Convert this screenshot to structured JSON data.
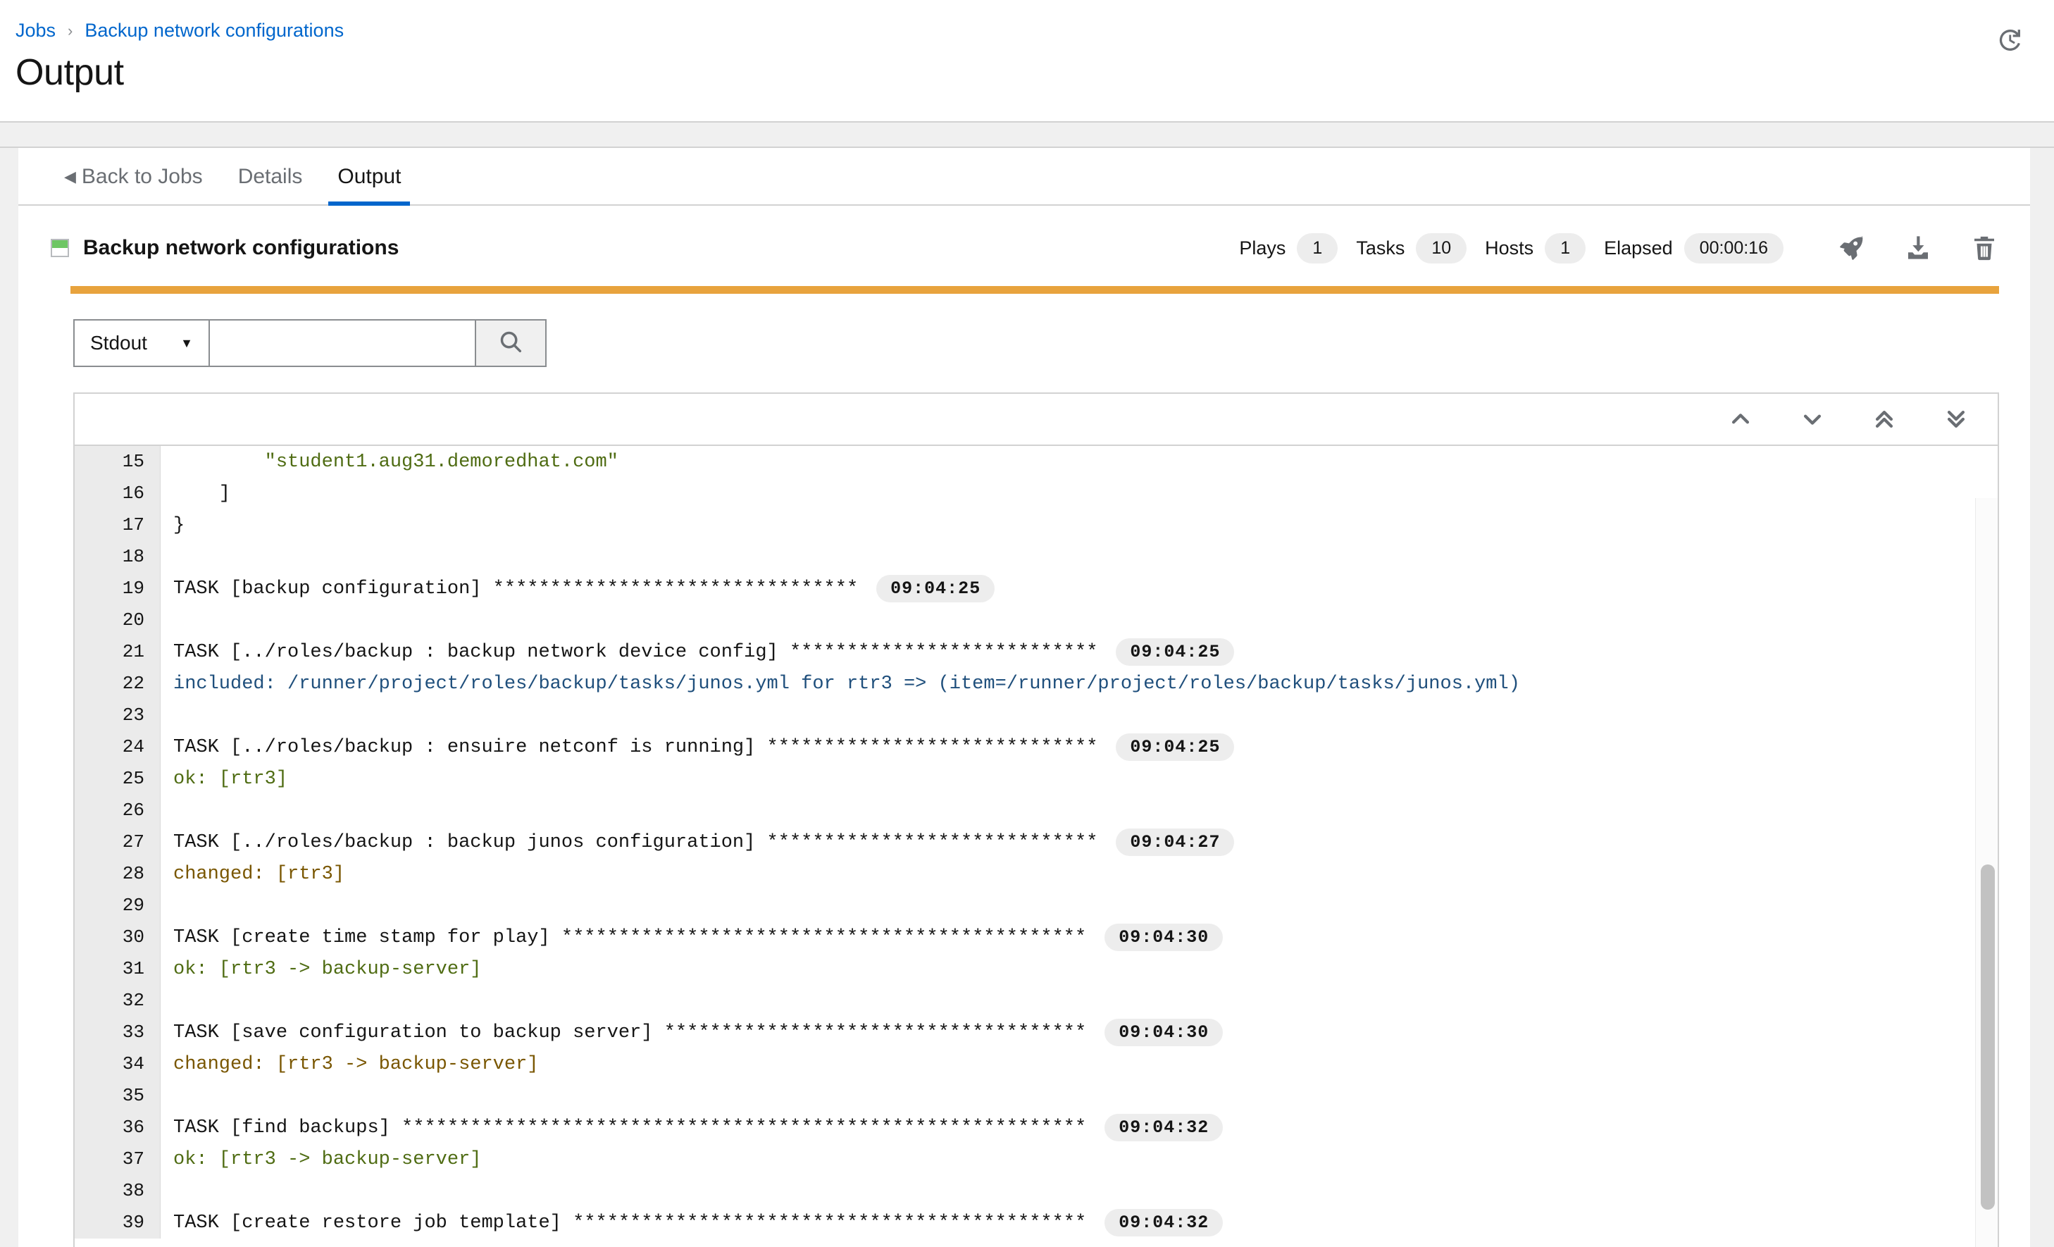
{
  "breadcrumb": {
    "items": [
      {
        "label": "Jobs",
        "link": true
      },
      {
        "label": "Backup network configurations",
        "link": true
      }
    ],
    "separator": "›"
  },
  "page_title": "Output",
  "header_icons": {
    "history": "history-icon"
  },
  "tabs": [
    {
      "label": "Back to Jobs",
      "active": false,
      "back_arrow": "◀"
    },
    {
      "label": "Details",
      "active": false
    },
    {
      "label": "Output",
      "active": true
    }
  ],
  "job": {
    "name": "Backup network configurations",
    "status_color_top": "#6ec664",
    "stats": [
      {
        "label": "Plays",
        "value": "1"
      },
      {
        "label": "Tasks",
        "value": "10"
      },
      {
        "label": "Hosts",
        "value": "1"
      },
      {
        "label": "Elapsed",
        "value": "00:00:16"
      }
    ],
    "actions": [
      {
        "name": "relaunch-job-button",
        "icon": "rocket-icon"
      },
      {
        "name": "download-output-button",
        "icon": "download-icon"
      },
      {
        "name": "delete-job-button",
        "icon": "trash-icon"
      }
    ],
    "progress_color": "#e8a33d"
  },
  "search": {
    "filter_label": "Stdout",
    "filter_caret": "▼",
    "input_value": "",
    "placeholder": "",
    "search_icon": "search-icon"
  },
  "console_nav": [
    {
      "name": "scroll-previous-button",
      "icon": "chevron-up-icon"
    },
    {
      "name": "scroll-next-button",
      "icon": "chevron-down-icon"
    },
    {
      "name": "scroll-first-button",
      "icon": "double-chevron-up-icon"
    },
    {
      "name": "scroll-last-button",
      "icon": "double-chevron-down-icon"
    }
  ],
  "output_lines": [
    {
      "num": "15",
      "indent": 8,
      "type": "str",
      "text": "\"student1.aug31.demoredhat.com\"",
      "stamp": ""
    },
    {
      "num": "16",
      "indent": 4,
      "type": "plain",
      "text": "]",
      "stamp": ""
    },
    {
      "num": "17",
      "indent": 0,
      "type": "plain",
      "text": "}",
      "stamp": ""
    },
    {
      "num": "18",
      "indent": 0,
      "type": "plain",
      "text": "",
      "stamp": ""
    },
    {
      "num": "19",
      "indent": 0,
      "type": "task",
      "text": "TASK [backup configuration] ********************************",
      "stamp": "09:04:25"
    },
    {
      "num": "20",
      "indent": 0,
      "type": "plain",
      "text": "",
      "stamp": ""
    },
    {
      "num": "21",
      "indent": 0,
      "type": "task",
      "text": "TASK [../roles/backup : backup network device config] ***************************",
      "stamp": "09:04:25"
    },
    {
      "num": "22",
      "indent": 0,
      "type": "included",
      "text": "included: /runner/project/roles/backup/tasks/junos.yml for rtr3 => (item=/runner/project/roles/backup/tasks/junos.yml)",
      "stamp": ""
    },
    {
      "num": "23",
      "indent": 0,
      "type": "plain",
      "text": "",
      "stamp": ""
    },
    {
      "num": "24",
      "indent": 0,
      "type": "task",
      "text": "TASK [../roles/backup : ensuire netconf is running] *****************************",
      "stamp": "09:04:25"
    },
    {
      "num": "25",
      "indent": 0,
      "type": "ok",
      "text": "ok: [rtr3]",
      "stamp": ""
    },
    {
      "num": "26",
      "indent": 0,
      "type": "plain",
      "text": "",
      "stamp": ""
    },
    {
      "num": "27",
      "indent": 0,
      "type": "task",
      "text": "TASK [../roles/backup : backup junos configuration] *****************************",
      "stamp": "09:04:27"
    },
    {
      "num": "28",
      "indent": 0,
      "type": "changed",
      "text": "changed: [rtr3]",
      "stamp": ""
    },
    {
      "num": "29",
      "indent": 0,
      "type": "plain",
      "text": "",
      "stamp": ""
    },
    {
      "num": "30",
      "indent": 0,
      "type": "task",
      "text": "TASK [create time stamp for play] **********************************************",
      "stamp": "09:04:30"
    },
    {
      "num": "31",
      "indent": 0,
      "type": "ok",
      "text": "ok: [rtr3 -> backup-server]",
      "stamp": ""
    },
    {
      "num": "32",
      "indent": 0,
      "type": "plain",
      "text": "",
      "stamp": ""
    },
    {
      "num": "33",
      "indent": 0,
      "type": "task",
      "text": "TASK [save configuration to backup server] *************************************",
      "stamp": "09:04:30"
    },
    {
      "num": "34",
      "indent": 0,
      "type": "changed",
      "text": "changed: [rtr3 -> backup-server]",
      "stamp": ""
    },
    {
      "num": "35",
      "indent": 0,
      "type": "plain",
      "text": "",
      "stamp": ""
    },
    {
      "num": "36",
      "indent": 0,
      "type": "task",
      "text": "TASK [find backups] ************************************************************",
      "stamp": "09:04:32"
    },
    {
      "num": "37",
      "indent": 0,
      "type": "ok",
      "text": "ok: [rtr3 -> backup-server]",
      "stamp": ""
    },
    {
      "num": "38",
      "indent": 0,
      "type": "plain",
      "text": "",
      "stamp": ""
    },
    {
      "num": "39",
      "indent": 0,
      "type": "task",
      "text": "TASK [create restore job template] *********************************************",
      "stamp": "09:04:32"
    }
  ]
}
